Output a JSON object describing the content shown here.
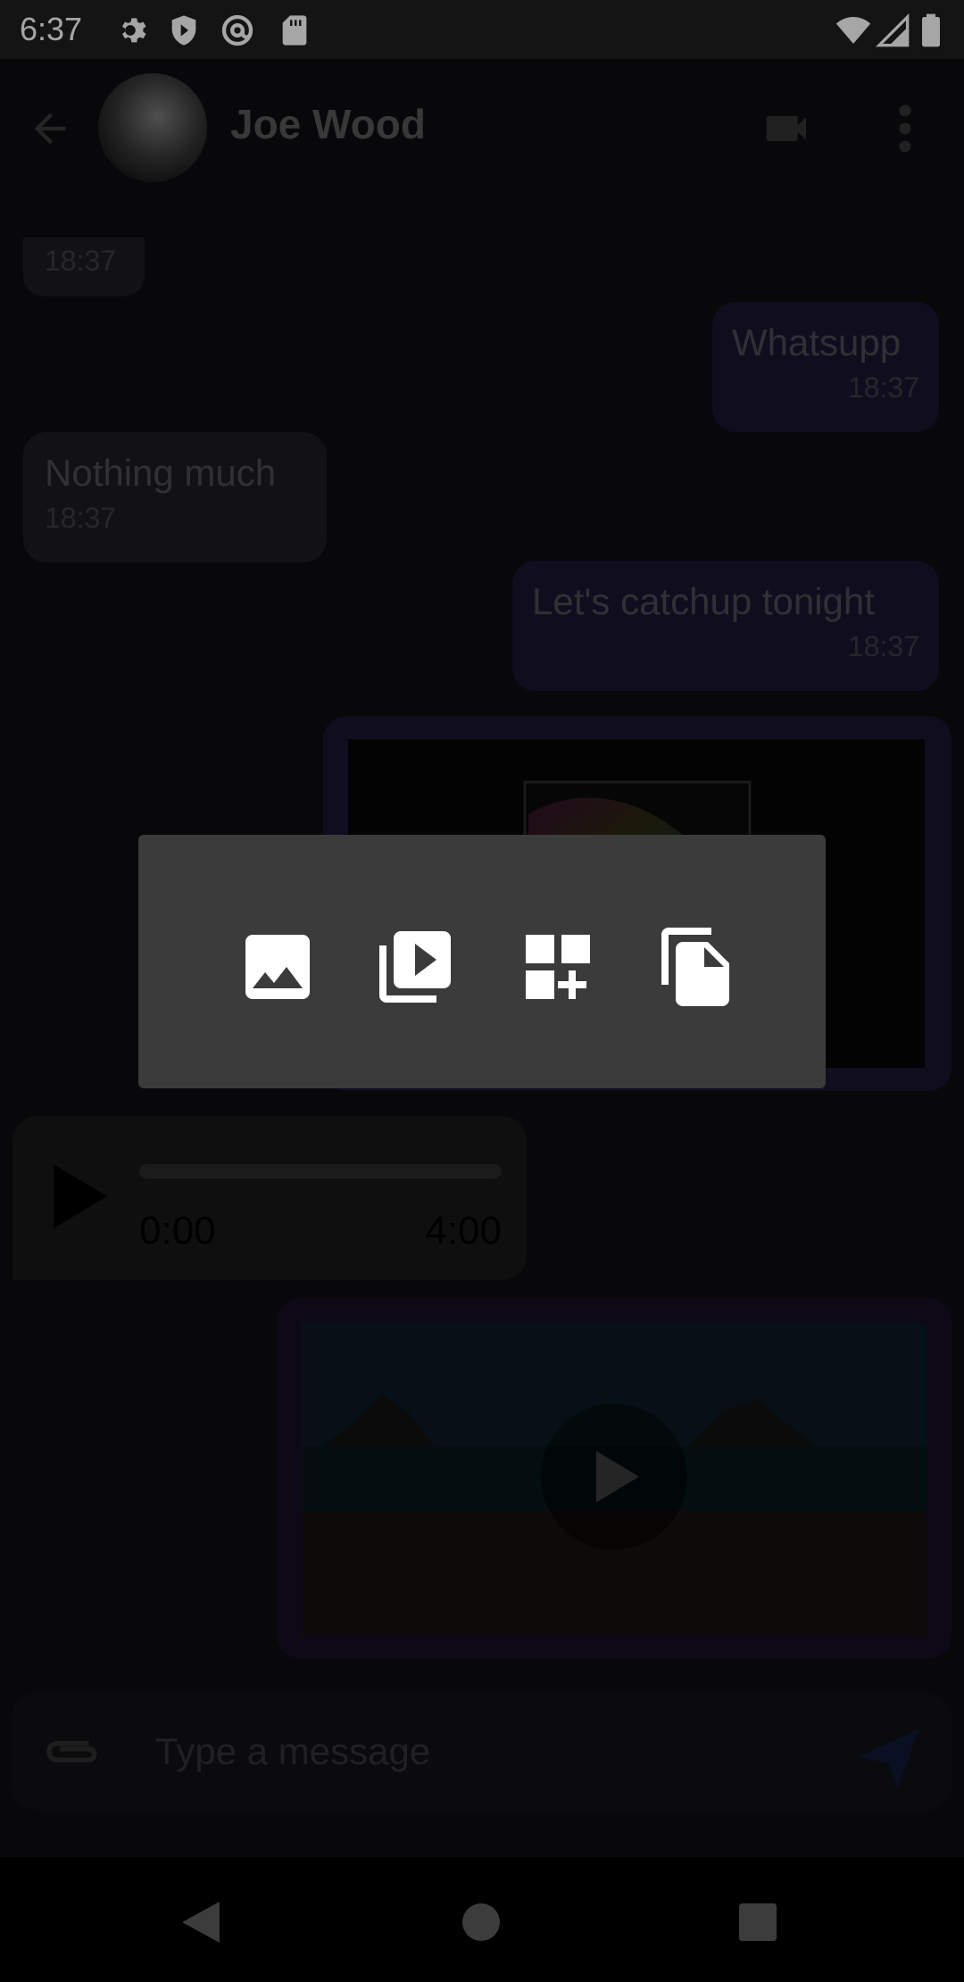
{
  "status_bar": {
    "time": "6:37",
    "icons": [
      "settings-icon",
      "shield-icon",
      "at-icon",
      "sd-card-icon",
      "wifi-icon",
      "signal-icon",
      "battery-icon"
    ]
  },
  "toolbar": {
    "back_icon": "arrow-left-icon",
    "contact_name": "Joe Wood",
    "video_call_icon": "video-camera-icon",
    "more_icon": "more-vert-icon"
  },
  "messages": [
    {
      "direction": "in",
      "text": "",
      "time": "18:37"
    },
    {
      "direction": "out",
      "text": "Whatsupp",
      "time": "18:37"
    },
    {
      "direction": "in",
      "text": "Nothing much",
      "time": "18:37"
    },
    {
      "direction": "out",
      "text": "Let's catchup tonight",
      "time": "18:37"
    },
    {
      "direction": "out",
      "type": "image"
    },
    {
      "direction": "in",
      "type": "audio",
      "position": "0:00",
      "duration": "4:00"
    },
    {
      "direction": "out",
      "type": "video"
    }
  ],
  "composer": {
    "attach_icon": "paperclip-icon",
    "placeholder": "Type a message",
    "send_icon": "send-icon"
  },
  "attachment_popup": {
    "options": [
      "image-icon",
      "video-library-icon",
      "widgets-add-icon",
      "file-copy-icon"
    ]
  },
  "nav_bar": {
    "back": "nav-back-icon",
    "home": "nav-home-icon",
    "recents": "nav-recents-icon"
  },
  "colors": {
    "status_bar": "#1f1f1f",
    "background": "#0d0c10",
    "popup": "#3b3b3b",
    "outgoing_bubble": "#1a1530",
    "incoming_bubble": "#1d1c21"
  }
}
